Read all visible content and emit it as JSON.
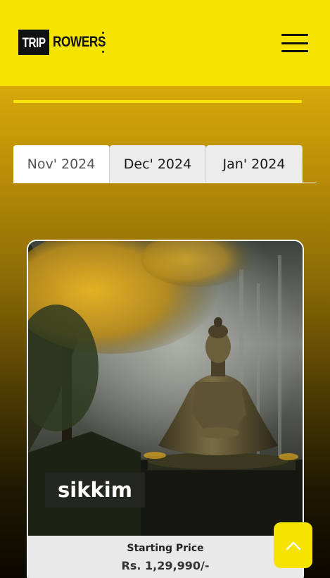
{
  "header": {
    "logo": {
      "part1": "TRIP",
      "part2": "ROWERS"
    },
    "menu_icon": "hamburger-menu-icon",
    "background": "#f5e400"
  },
  "tabs": [
    {
      "label": "Nov' 2024",
      "active": true
    },
    {
      "label": "Dec' 2024",
      "active": false
    },
    {
      "label": "Jan' 2024",
      "active": false
    }
  ],
  "card": {
    "title": "sikkim",
    "price_label": "Starting Price",
    "price_value": "Rs. 1,29,990/-"
  },
  "scroll_top": {
    "icon": "chevron-up-icon"
  },
  "colors": {
    "accent": "#f5e400",
    "dark": "#111111"
  }
}
